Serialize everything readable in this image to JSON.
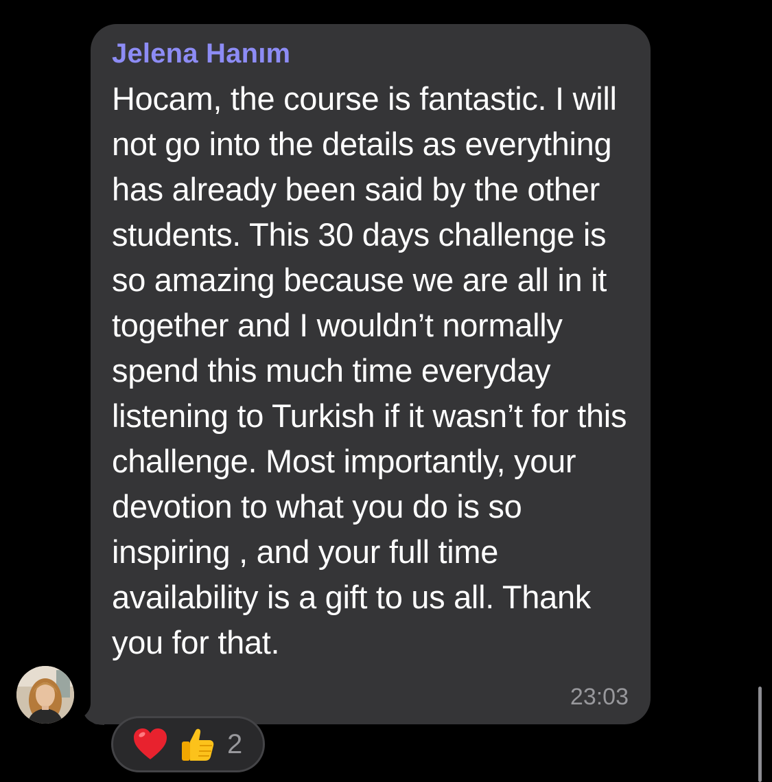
{
  "message": {
    "sender": "Jelena Hanım",
    "text": "Hocam, the course is fantastic. I will not go into the details as everything has already been said by the other students. This 30 days challenge is so amazing because we are all in it together and I wouldn’t normally spend this much time everyday listening to Turkish if it wasn’t for this challenge.  Most importantly, your devotion to what you do is so inspiring , and your full time availability is a gift to us all. Thank you for that.",
    "time": "23:03",
    "avatar_icon": "user-avatar-photo"
  },
  "reactions": {
    "items": [
      {
        "icon": "red-heart-icon"
      },
      {
        "icon": "thumbs-up-icon"
      }
    ],
    "count": "2"
  },
  "colors": {
    "background": "#000000",
    "bubble": "#353537",
    "sender_name": "#8d8cf5",
    "message_text": "#ffffff",
    "timestamp": "#98989c"
  }
}
